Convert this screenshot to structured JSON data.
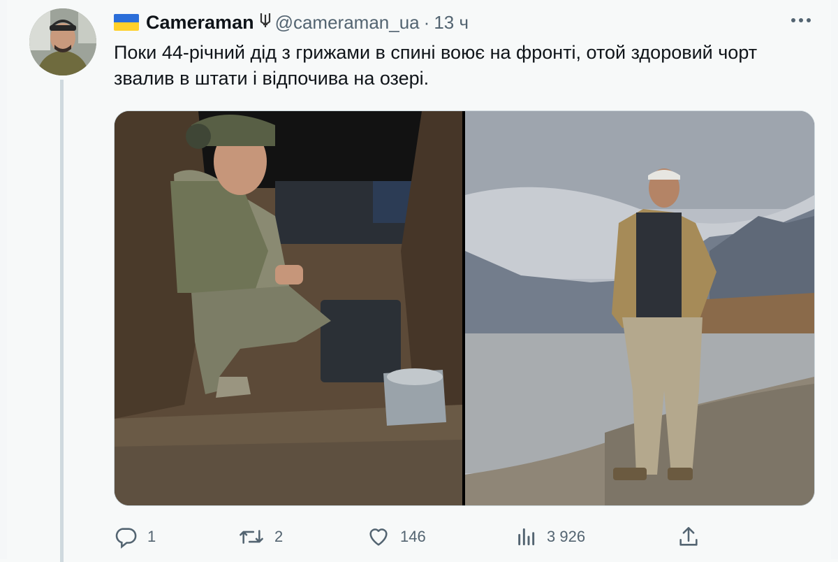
{
  "author": {
    "name": "Cameraman",
    "badge_icon": "trident-icon",
    "handle": "@cameraman_ua",
    "separator": "·",
    "time": "13 ч",
    "flag_colors": [
      "#2b6ed9",
      "#ffd02a"
    ]
  },
  "tweet": {
    "text": "Поки 44-річний дід з грижами в спині воює на фронті, отой здоровий чорт звалив в штати і відпочива на озері."
  },
  "media": {
    "photos": [
      {
        "subject": "soldier-in-trench"
      },
      {
        "subject": "man-by-lake"
      }
    ]
  },
  "actions": {
    "reply": {
      "icon": "reply-icon",
      "count": "1"
    },
    "retweet": {
      "icon": "retweet-icon",
      "count": "2"
    },
    "like": {
      "icon": "heart-icon",
      "count": "146"
    },
    "views": {
      "icon": "views-icon",
      "count": "3 926"
    },
    "share": {
      "icon": "share-icon"
    }
  },
  "colors": {
    "text": "#0f1419",
    "secondary": "#536471",
    "border": "#cfd9de",
    "background": "#f7f9f9"
  }
}
